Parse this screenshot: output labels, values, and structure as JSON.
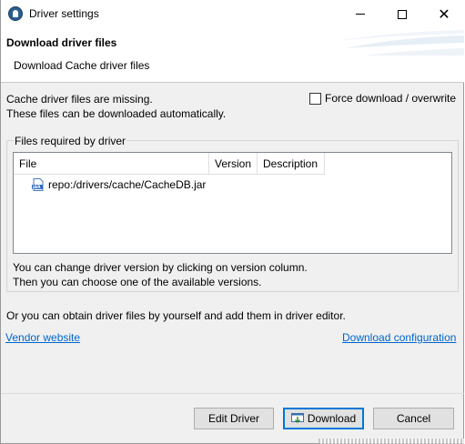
{
  "window": {
    "title": "Driver settings"
  },
  "banner": {
    "title": "Download driver files",
    "subtitle": "Download Cache driver files"
  },
  "status": {
    "line1": "Cache driver files are missing.",
    "line2": "These files can be downloaded automatically."
  },
  "force": {
    "label": "Force download / overwrite",
    "checked": false
  },
  "files_group": {
    "label": "Files required by driver",
    "columns": [
      "File",
      "Version",
      "Description"
    ],
    "rows": [
      {
        "file": "repo:/drivers/cache/CacheDB.jar",
        "version": "",
        "description": "",
        "icon": "jar-file-icon"
      }
    ],
    "hint1": "You can change driver version by clicking on version column.",
    "hint2": "Then you can choose one of the available versions."
  },
  "obtain_text": "Or you can obtain driver files by yourself and add them in driver editor.",
  "links": {
    "vendor": "Vendor website",
    "download_config": "Download configuration"
  },
  "buttons": {
    "edit": "Edit Driver",
    "download": "Download",
    "cancel": "Cancel"
  },
  "colors": {
    "link": "#0066cc",
    "default_button_border": "#0078d7"
  }
}
